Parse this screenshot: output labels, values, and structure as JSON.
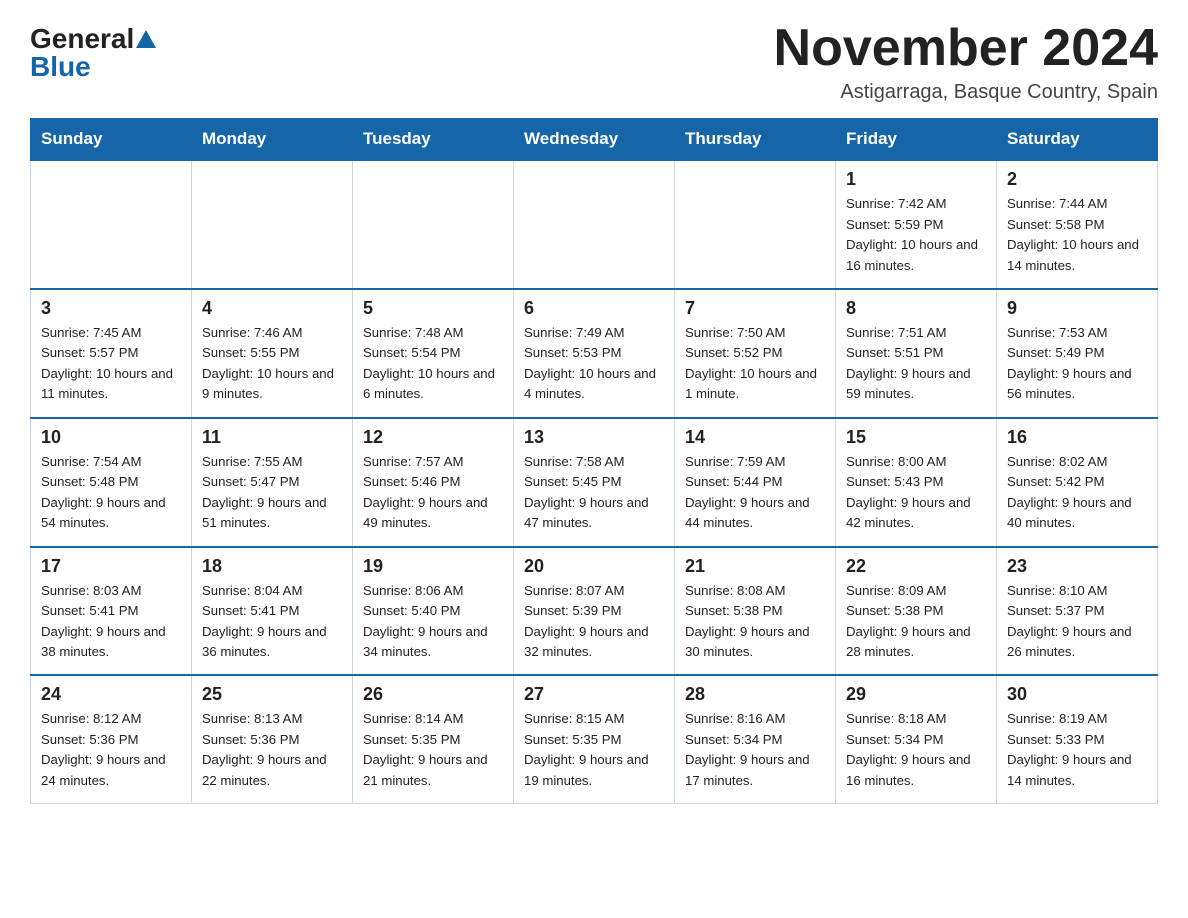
{
  "logo": {
    "general": "General",
    "blue": "Blue"
  },
  "title": "November 2024",
  "location": "Astigarraga, Basque Country, Spain",
  "weekdays": [
    "Sunday",
    "Monday",
    "Tuesday",
    "Wednesday",
    "Thursday",
    "Friday",
    "Saturday"
  ],
  "weeks": [
    [
      {
        "day": "",
        "info": ""
      },
      {
        "day": "",
        "info": ""
      },
      {
        "day": "",
        "info": ""
      },
      {
        "day": "",
        "info": ""
      },
      {
        "day": "",
        "info": ""
      },
      {
        "day": "1",
        "info": "Sunrise: 7:42 AM\nSunset: 5:59 PM\nDaylight: 10 hours and 16 minutes."
      },
      {
        "day": "2",
        "info": "Sunrise: 7:44 AM\nSunset: 5:58 PM\nDaylight: 10 hours and 14 minutes."
      }
    ],
    [
      {
        "day": "3",
        "info": "Sunrise: 7:45 AM\nSunset: 5:57 PM\nDaylight: 10 hours and 11 minutes."
      },
      {
        "day": "4",
        "info": "Sunrise: 7:46 AM\nSunset: 5:55 PM\nDaylight: 10 hours and 9 minutes."
      },
      {
        "day": "5",
        "info": "Sunrise: 7:48 AM\nSunset: 5:54 PM\nDaylight: 10 hours and 6 minutes."
      },
      {
        "day": "6",
        "info": "Sunrise: 7:49 AM\nSunset: 5:53 PM\nDaylight: 10 hours and 4 minutes."
      },
      {
        "day": "7",
        "info": "Sunrise: 7:50 AM\nSunset: 5:52 PM\nDaylight: 10 hours and 1 minute."
      },
      {
        "day": "8",
        "info": "Sunrise: 7:51 AM\nSunset: 5:51 PM\nDaylight: 9 hours and 59 minutes."
      },
      {
        "day": "9",
        "info": "Sunrise: 7:53 AM\nSunset: 5:49 PM\nDaylight: 9 hours and 56 minutes."
      }
    ],
    [
      {
        "day": "10",
        "info": "Sunrise: 7:54 AM\nSunset: 5:48 PM\nDaylight: 9 hours and 54 minutes."
      },
      {
        "day": "11",
        "info": "Sunrise: 7:55 AM\nSunset: 5:47 PM\nDaylight: 9 hours and 51 minutes."
      },
      {
        "day": "12",
        "info": "Sunrise: 7:57 AM\nSunset: 5:46 PM\nDaylight: 9 hours and 49 minutes."
      },
      {
        "day": "13",
        "info": "Sunrise: 7:58 AM\nSunset: 5:45 PM\nDaylight: 9 hours and 47 minutes."
      },
      {
        "day": "14",
        "info": "Sunrise: 7:59 AM\nSunset: 5:44 PM\nDaylight: 9 hours and 44 minutes."
      },
      {
        "day": "15",
        "info": "Sunrise: 8:00 AM\nSunset: 5:43 PM\nDaylight: 9 hours and 42 minutes."
      },
      {
        "day": "16",
        "info": "Sunrise: 8:02 AM\nSunset: 5:42 PM\nDaylight: 9 hours and 40 minutes."
      }
    ],
    [
      {
        "day": "17",
        "info": "Sunrise: 8:03 AM\nSunset: 5:41 PM\nDaylight: 9 hours and 38 minutes."
      },
      {
        "day": "18",
        "info": "Sunrise: 8:04 AM\nSunset: 5:41 PM\nDaylight: 9 hours and 36 minutes."
      },
      {
        "day": "19",
        "info": "Sunrise: 8:06 AM\nSunset: 5:40 PM\nDaylight: 9 hours and 34 minutes."
      },
      {
        "day": "20",
        "info": "Sunrise: 8:07 AM\nSunset: 5:39 PM\nDaylight: 9 hours and 32 minutes."
      },
      {
        "day": "21",
        "info": "Sunrise: 8:08 AM\nSunset: 5:38 PM\nDaylight: 9 hours and 30 minutes."
      },
      {
        "day": "22",
        "info": "Sunrise: 8:09 AM\nSunset: 5:38 PM\nDaylight: 9 hours and 28 minutes."
      },
      {
        "day": "23",
        "info": "Sunrise: 8:10 AM\nSunset: 5:37 PM\nDaylight: 9 hours and 26 minutes."
      }
    ],
    [
      {
        "day": "24",
        "info": "Sunrise: 8:12 AM\nSunset: 5:36 PM\nDaylight: 9 hours and 24 minutes."
      },
      {
        "day": "25",
        "info": "Sunrise: 8:13 AM\nSunset: 5:36 PM\nDaylight: 9 hours and 22 minutes."
      },
      {
        "day": "26",
        "info": "Sunrise: 8:14 AM\nSunset: 5:35 PM\nDaylight: 9 hours and 21 minutes."
      },
      {
        "day": "27",
        "info": "Sunrise: 8:15 AM\nSunset: 5:35 PM\nDaylight: 9 hours and 19 minutes."
      },
      {
        "day": "28",
        "info": "Sunrise: 8:16 AM\nSunset: 5:34 PM\nDaylight: 9 hours and 17 minutes."
      },
      {
        "day": "29",
        "info": "Sunrise: 8:18 AM\nSunset: 5:34 PM\nDaylight: 9 hours and 16 minutes."
      },
      {
        "day": "30",
        "info": "Sunrise: 8:19 AM\nSunset: 5:33 PM\nDaylight: 9 hours and 14 minutes."
      }
    ]
  ],
  "accent_color": "#1565a8"
}
